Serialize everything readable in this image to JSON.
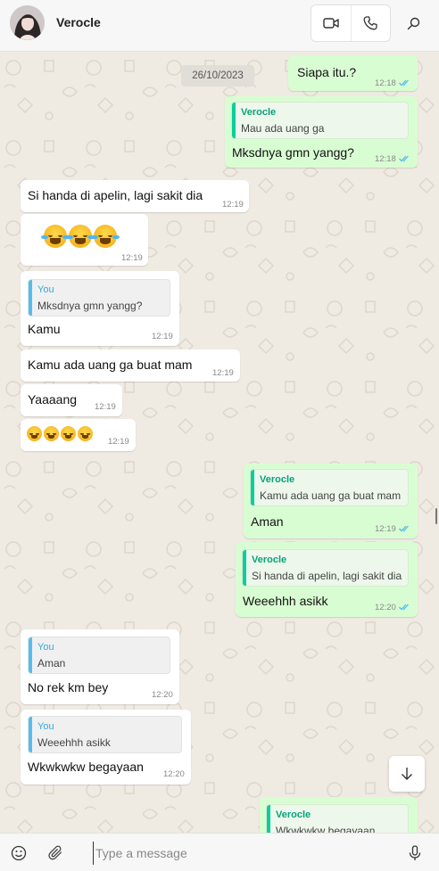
{
  "header": {
    "contact_name": "Verocle",
    "icons": [
      "video-icon",
      "phone-icon",
      "search-icon"
    ]
  },
  "chat": {
    "date_chip": "26/10/2023",
    "messages": [
      {
        "dir": "out",
        "text": "Siapa itu.?",
        "time": "12:18",
        "read": true
      },
      {
        "dir": "out",
        "quote_author": "Verocle",
        "quote_text": "Mau ada uang ga",
        "text": "Mksdnya gmn yangg?",
        "time": "12:18",
        "read": true
      },
      {
        "dir": "in",
        "text": "Si handa di apelin, lagi sakit dia",
        "time": "12:19"
      },
      {
        "dir": "in",
        "emoji": "😂😂😂",
        "time": "12:19"
      },
      {
        "dir": "in",
        "quote_author": "You",
        "quote_text": "Mksdnya gmn yangg?",
        "text": "Kamu",
        "time": "12:19"
      },
      {
        "dir": "in",
        "text": "Kamu ada uang ga buat mam",
        "time": "12:19"
      },
      {
        "dir": "in",
        "text": "Yaaaang",
        "time": "12:19"
      },
      {
        "dir": "in",
        "emoji": "😭😭😭😭",
        "time": "12:19"
      },
      {
        "dir": "out",
        "quote_author": "Verocle",
        "quote_text": "Kamu ada uang ga buat mam",
        "text": "Aman",
        "time": "12:19",
        "read": true
      },
      {
        "dir": "out",
        "quote_author": "Verocle",
        "quote_text": "Si handa di apelin, lagi sakit dia",
        "text": "Weeehhh asikk",
        "time": "12:20",
        "read": true
      },
      {
        "dir": "in",
        "quote_author": "You",
        "quote_text": "Aman",
        "text": "No rek km bey",
        "time": "12:20"
      },
      {
        "dir": "in",
        "quote_author": "You",
        "quote_text": "Weeehhh asikk",
        "text": "Wkwkwkw begayaan",
        "time": "12:20"
      },
      {
        "dir": "out",
        "quote_author": "Verocle",
        "quote_text": "Wkwkwkw begayaan",
        "text": "",
        "time": ""
      }
    ]
  },
  "composer": {
    "placeholder": "Type a message"
  },
  "colors": {
    "incoming": "#ffffff",
    "outgoing": "#d9fdd3",
    "read_tick": "#53bdeb",
    "quote_you": "#35a9de",
    "quote_verocle": "#06a37c"
  }
}
